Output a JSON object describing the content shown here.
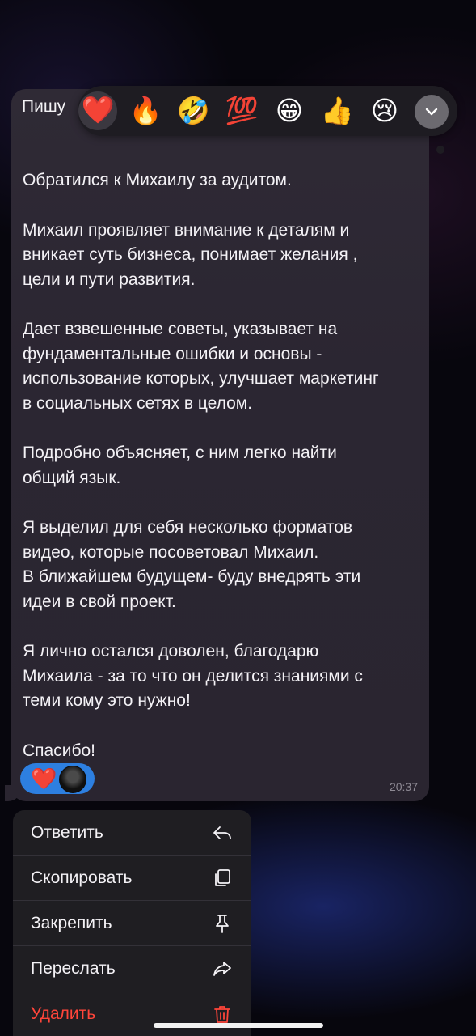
{
  "message": {
    "sender": "Пишу",
    "paragraphs": [
      [
        "Обратился к Михаилу за аудитом."
      ],
      [
        "Михаил проявляет внимание к деталям и",
        "вникает суть бизнеса, понимает желания ,",
        "цели и пути развития."
      ],
      [
        "Дает взвешенные советы, указывает на",
        "фундаментальные ошибки и основы -",
        "использование которых, улучшает маркетинг",
        "в социальных сетях в целом."
      ],
      [
        "Подробно объясняет, с ним легко найти",
        "общий язык."
      ],
      [
        "Я выделил для себя несколько форматов",
        "видео, которые посоветовал Михаил.",
        "В ближайшем будущем- буду внедрять эти",
        "идеи в свой проект."
      ],
      [
        "Я лично остался доволен, благодарю",
        "Михаила - за то что он делится знаниями с",
        "теми кому это нужно!"
      ],
      [
        "Спасибо!"
      ]
    ],
    "time": "20:37",
    "reaction": "❤️"
  },
  "reactions": [
    {
      "name": "heart",
      "glyph": "❤️"
    },
    {
      "name": "fire",
      "glyph": "🔥"
    },
    {
      "name": "rofl",
      "glyph": "🤣"
    },
    {
      "name": "hundred",
      "glyph": "💯"
    },
    {
      "name": "grin",
      "glyph": "😁"
    },
    {
      "name": "thumbs-up",
      "glyph": "👍"
    },
    {
      "name": "crying",
      "glyph": "😢"
    }
  ],
  "menu": {
    "reply": "Ответить",
    "copy": "Скопировать",
    "pin": "Закрепить",
    "forward": "Переслать",
    "delete": "Удалить"
  },
  "colors": {
    "accent": "#2d7fe0",
    "danger": "#ff453a"
  }
}
